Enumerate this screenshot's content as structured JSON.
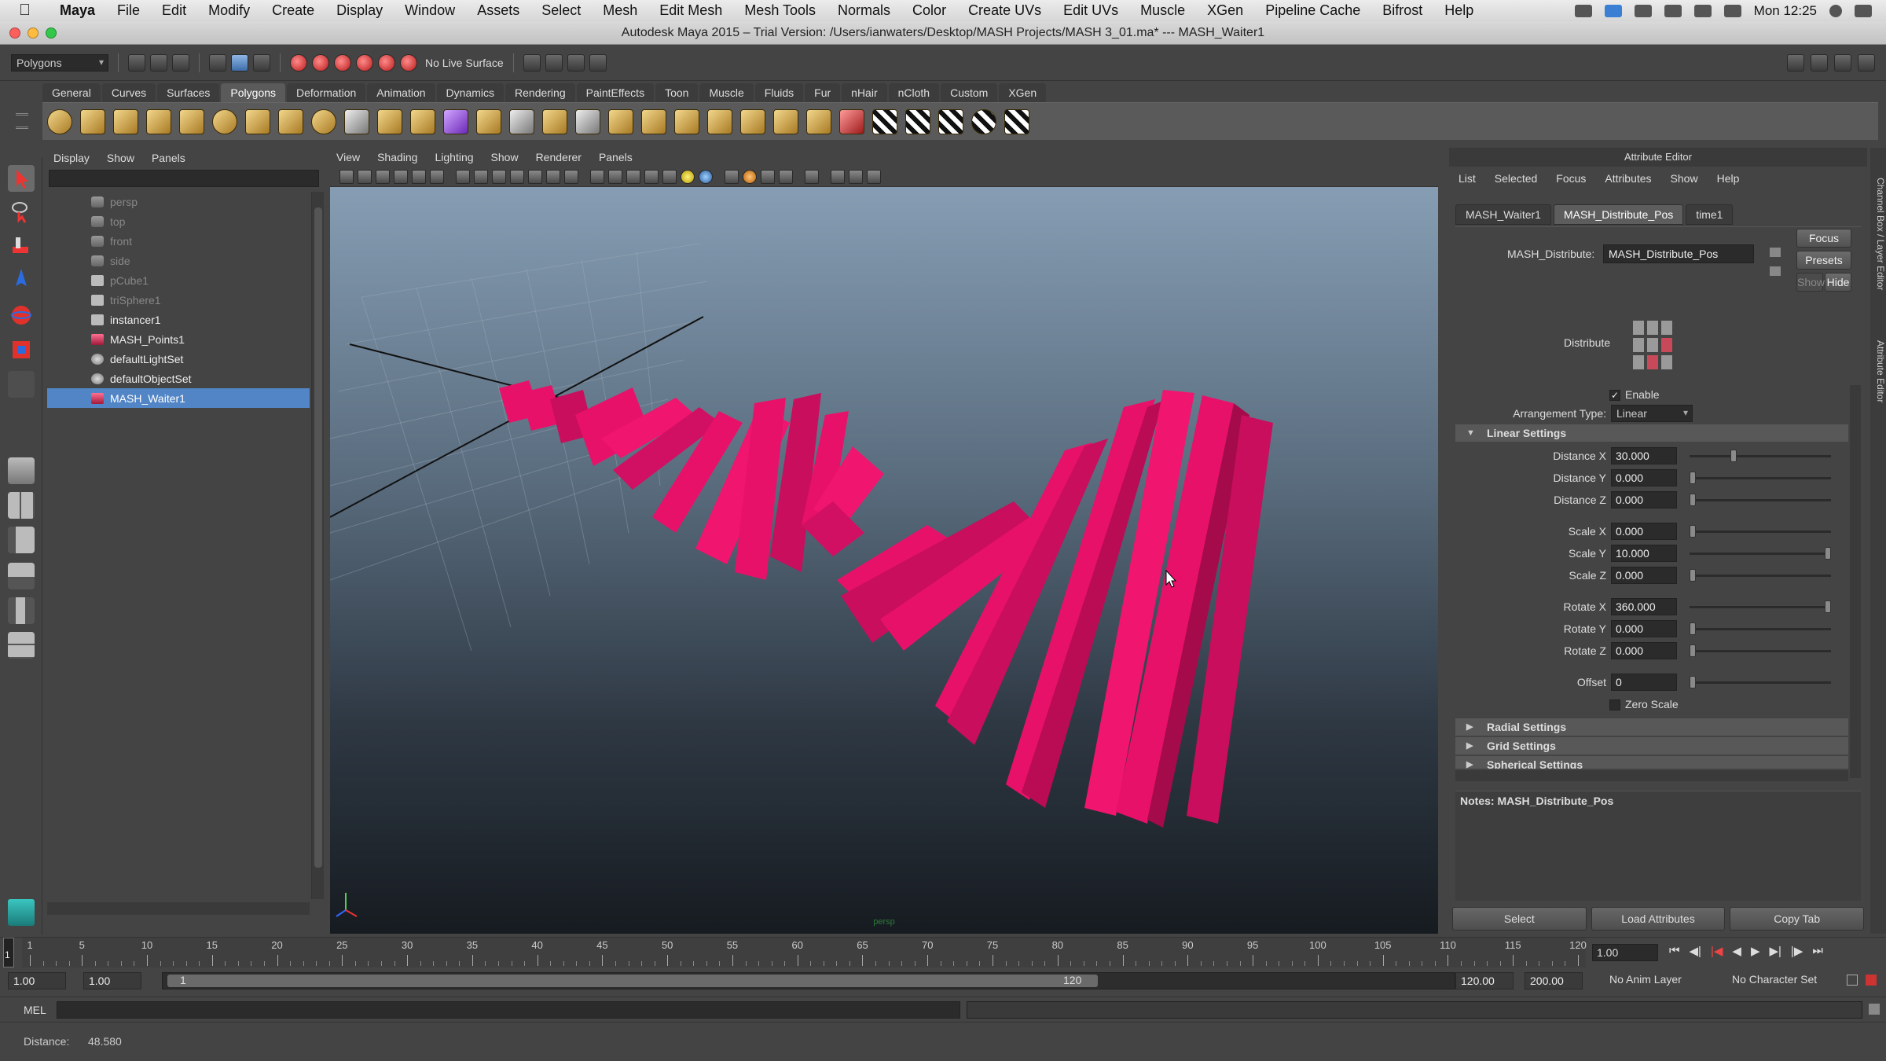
{
  "mac_menubar": {
    "items": [
      "Maya",
      "File",
      "Edit",
      "Modify",
      "Create",
      "Display",
      "Window",
      "Assets",
      "Select",
      "Mesh",
      "Edit Mesh",
      "Mesh Tools",
      "Normals",
      "Color",
      "Create UVs",
      "Edit UVs",
      "Muscle",
      "XGen",
      "Pipeline Cache",
      "Bifrost",
      "Help"
    ],
    "clock": "Mon 12:25"
  },
  "window": {
    "title": "Autodesk Maya 2015 – Trial Version: /Users/ianwaters/Desktop/MASH Projects/MASH 3_01.ma*   ---   MASH_Waiter1"
  },
  "statusline": {
    "menuset": "Polygons",
    "live_surface": "No Live Surface"
  },
  "shelf": {
    "tabs": [
      "General",
      "Curves",
      "Surfaces",
      "Polygons",
      "Deformation",
      "Animation",
      "Dynamics",
      "Rendering",
      "PaintEffects",
      "Toon",
      "Muscle",
      "Fluids",
      "Fur",
      "nHair",
      "nCloth",
      "Custom",
      "XGen"
    ],
    "active_tab": "Polygons"
  },
  "outliner": {
    "menus": [
      "Display",
      "Show",
      "Panels"
    ],
    "items": [
      {
        "label": "persp",
        "dim": true,
        "icon": "camera-icon"
      },
      {
        "label": "top",
        "dim": true,
        "icon": "camera-icon"
      },
      {
        "label": "front",
        "dim": true,
        "icon": "camera-icon"
      },
      {
        "label": "side",
        "dim": true,
        "icon": "camera-icon"
      },
      {
        "label": "pCube1",
        "dim": true,
        "icon": "transform-icon"
      },
      {
        "label": "triSphere1",
        "dim": true,
        "icon": "transform-icon"
      },
      {
        "label": "instancer1",
        "dim": false,
        "icon": "instancer-icon"
      },
      {
        "label": "MASH_Points1",
        "dim": false,
        "icon": "mash-points-icon"
      },
      {
        "label": "defaultLightSet",
        "dim": false,
        "icon": "set-icon"
      },
      {
        "label": "defaultObjectSet",
        "dim": false,
        "icon": "set-icon"
      },
      {
        "label": "MASH_Waiter1",
        "dim": false,
        "icon": "mash-waiter-icon",
        "selected": true
      }
    ]
  },
  "viewport": {
    "menus": [
      "View",
      "Shading",
      "Lighting",
      "Show",
      "Renderer",
      "Panels"
    ],
    "camera_label": "persp"
  },
  "attribute_editor": {
    "title": "Attribute Editor",
    "menus": [
      "List",
      "Selected",
      "Focus",
      "Attributes",
      "Show",
      "Help"
    ],
    "tabs": [
      "MASH_Waiter1",
      "MASH_Distribute_Pos",
      "time1"
    ],
    "active_tab": "MASH_Distribute_Pos",
    "node_label": "MASH_Distribute:",
    "node_name": "MASH_Distribute_Pos",
    "buttons": {
      "focus": "Focus",
      "presets": "Presets",
      "show": "Show",
      "hide": "Hide"
    },
    "distribute_label": "Distribute",
    "enable_label": "Enable",
    "enable_checked": true,
    "arrangement_label": "Arrangement Type:",
    "arrangement_value": "Linear",
    "linear_section": "Linear Settings",
    "fields": [
      {
        "label": "Distance X",
        "value": "30.000",
        "slider": 0.3
      },
      {
        "label": "Distance Y",
        "value": "0.000",
        "slider": 0.0
      },
      {
        "label": "Distance Z",
        "value": "0.000",
        "slider": 0.0
      },
      {
        "label": "Scale X",
        "value": "0.000",
        "slider": 0.0
      },
      {
        "label": "Scale Y",
        "value": "10.000",
        "slider": 1.0
      },
      {
        "label": "Scale Z",
        "value": "0.000",
        "slider": 0.0
      },
      {
        "label": "Rotate X",
        "value": "360.000",
        "slider": 1.0
      },
      {
        "label": "Rotate Y",
        "value": "0.000",
        "slider": 0.0
      },
      {
        "label": "Rotate Z",
        "value": "0.000",
        "slider": 0.0
      },
      {
        "label": "Offset",
        "value": "0",
        "slider": 0.0
      }
    ],
    "zero_scale_label": "Zero Scale",
    "collapsed_sections": [
      "Radial Settings",
      "Grid Settings",
      "Spherical Settings"
    ],
    "notes_label": "Notes:  MASH_Distribute_Pos",
    "bottom_buttons": [
      "Select",
      "Load Attributes",
      "Copy Tab"
    ]
  },
  "side_strip": {
    "labels": [
      "Channel Box / Layer Editor",
      "Attribute Editor"
    ]
  },
  "timeline": {
    "labels": [
      "1",
      "5",
      "10",
      "15",
      "20",
      "25",
      "30",
      "35",
      "40",
      "45",
      "50",
      "55",
      "60",
      "65",
      "70",
      "75",
      "80",
      "85",
      "90",
      "95",
      "100",
      "105",
      "110",
      "115",
      "120"
    ],
    "current_frame": "1.00",
    "playhead_label": "1"
  },
  "range": {
    "start_time": "1.00",
    "playback_start": "1.00",
    "range_start_label": "1",
    "range_end_label": "120",
    "playback_end": "120.00",
    "end_time": "200.00",
    "anim_layer": "No Anim Layer",
    "character_set": "No Character Set"
  },
  "command_line": {
    "language": "MEL"
  },
  "help_line": {
    "text": "Distance:",
    "value": "48.580"
  },
  "colors": {
    "accent": "#5285c6",
    "object": "#e8116a",
    "object_dark": "#a50b4b"
  }
}
